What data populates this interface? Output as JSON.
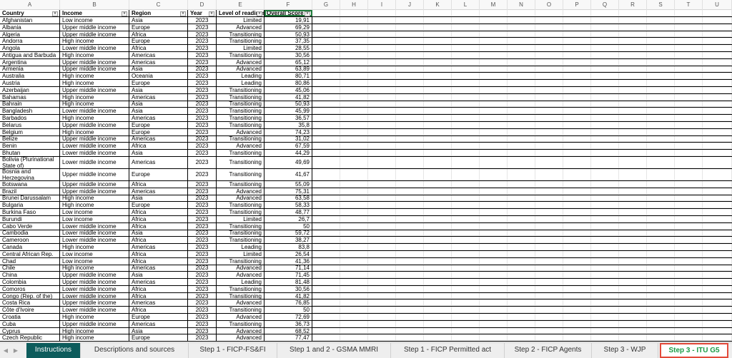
{
  "columns": [
    "A",
    "B",
    "C",
    "D",
    "E",
    "F",
    "G",
    "H",
    "I",
    "J",
    "K",
    "L",
    "M",
    "N",
    "O",
    "P",
    "Q",
    "R",
    "S",
    "T",
    "U"
  ],
  "table_headers": [
    "Country",
    "Income",
    "Region",
    "Year",
    "Level of readiness",
    "Overall Score"
  ],
  "rows": [
    [
      "Afghanistan",
      "Low income",
      "Asia",
      "2023",
      "Limited",
      "19,91"
    ],
    [
      "Albania",
      "Upper middle income",
      "Europe",
      "2023",
      "Advanced",
      "69,29"
    ],
    [
      "Algeria",
      "Upper middle income",
      "Africa",
      "2023",
      "Transitioning",
      "50,93"
    ],
    [
      "Andorra",
      "High income",
      "Europe",
      "2023",
      "Transitioning",
      "37,35"
    ],
    [
      "Angola",
      "Lower middle income",
      "Africa",
      "2023",
      "Limited",
      "28,55"
    ],
    [
      "Antigua and Barbuda",
      "High income",
      "Americas",
      "2023",
      "Transitioning",
      "30,56"
    ],
    [
      "Argentina",
      "Upper middle income",
      "Americas",
      "2023",
      "Advanced",
      "65,12"
    ],
    [
      "Armenia",
      "Upper middle income",
      "Asia",
      "2023",
      "Advanced",
      "63,89"
    ],
    [
      "Australia",
      "High income",
      "Oceania",
      "2023",
      "Leading",
      "80,71"
    ],
    [
      "Austria",
      "High income",
      "Europe",
      "2023",
      "Leading",
      "80,86"
    ],
    [
      "Azerbaijan",
      "Upper middle income",
      "Asia",
      "2023",
      "Transitioning",
      "45,06"
    ],
    [
      "Bahamas",
      "High income",
      "Americas",
      "2023",
      "Transitioning",
      "41,82"
    ],
    [
      "Bahrain",
      "High income",
      "Asia",
      "2023",
      "Transitioning",
      "50,93"
    ],
    [
      "Bangladesh",
      "Lower middle income",
      "Asia",
      "2023",
      "Transitioning",
      "45,99"
    ],
    [
      "Barbados",
      "High income",
      "Americas",
      "2023",
      "Transitioning",
      "36,57"
    ],
    [
      "Belarus",
      "Upper middle income",
      "Europe",
      "2023",
      "Transitioning",
      "35,8"
    ],
    [
      "Belgium",
      "High income",
      "Europe",
      "2023",
      "Advanced",
      "74,23"
    ],
    [
      "Belize",
      "Upper middle income",
      "Americas",
      "2023",
      "Transitioning",
      "31,02"
    ],
    [
      "Benin",
      "Lower middle income",
      "Africa",
      "2023",
      "Advanced",
      "67,59"
    ],
    [
      "Bhutan",
      "Lower middle income",
      "Asia",
      "2023",
      "Transitioning",
      "44,29"
    ],
    [
      "Bolivia (Plurinational State of)",
      "Lower middle income",
      "Americas",
      "2023",
      "Transitioning",
      "49,69"
    ],
    [
      "Bosnia and Herzegovina",
      "Upper middle income",
      "Europe",
      "2023",
      "Transitioning",
      "41,67"
    ],
    [
      "Botswana",
      "Upper middle income",
      "Africa",
      "2023",
      "Transitioning",
      "55,09"
    ],
    [
      "Brazil",
      "Upper middle income",
      "Americas",
      "2023",
      "Advanced",
      "75,31"
    ],
    [
      "Brunei Darussalam",
      "High income",
      "Asia",
      "2023",
      "Advanced",
      "63,58"
    ],
    [
      "Bulgaria",
      "High income",
      "Europe",
      "2023",
      "Transitioning",
      "58,33"
    ],
    [
      "Burkina Faso",
      "Low income",
      "Africa",
      "2023",
      "Transitioning",
      "48,77"
    ],
    [
      "Burundi",
      "Low income",
      "Africa",
      "2023",
      "Limited",
      "26,7"
    ],
    [
      "Cabo Verde",
      "Lower middle income",
      "Africa",
      "2023",
      "Transitioning",
      "50"
    ],
    [
      "Cambodia",
      "Lower middle income",
      "Asia",
      "2023",
      "Transitioning",
      "59,72"
    ],
    [
      "Cameroon",
      "Lower middle income",
      "Africa",
      "2023",
      "Transitioning",
      "38,27"
    ],
    [
      "Canada",
      "High income",
      "Americas",
      "2023",
      "Leading",
      "83,8"
    ],
    [
      "Central African Rep.",
      "Low income",
      "Africa",
      "2023",
      "Limited",
      "26,54"
    ],
    [
      "Chad",
      "Low income",
      "Africa",
      "2023",
      "Transitioning",
      "41,36"
    ],
    [
      "Chile",
      "High income",
      "Americas",
      "2023",
      "Advanced",
      "71,14"
    ],
    [
      "China",
      "Upper middle income",
      "Asia",
      "2023",
      "Advanced",
      "71,45"
    ],
    [
      "Colombia",
      "Upper middle income",
      "Americas",
      "2023",
      "Leading",
      "81,48"
    ],
    [
      "Comoros",
      "Lower middle income",
      "Africa",
      "2023",
      "Transitioning",
      "30,56"
    ],
    [
      "Congo (Rep. of the)",
      "Lower middle income",
      "Africa",
      "2023",
      "Transitioning",
      "41,82"
    ],
    [
      "Costa Rica",
      "Upper middle income",
      "Americas",
      "2023",
      "Advanced",
      "76,85"
    ],
    [
      "Côte d'Ivoire",
      "Lower middle income",
      "Africa",
      "2023",
      "Transitioning",
      "50"
    ],
    [
      "Croatia",
      "High income",
      "Europe",
      "2023",
      "Advanced",
      "72,69"
    ],
    [
      "Cuba",
      "Upper middle income",
      "Americas",
      "2023",
      "Transitioning",
      "36,73"
    ],
    [
      "Cyprus",
      "High income",
      "Asia",
      "2023",
      "Advanced",
      "68,52"
    ],
    [
      "Czech Republic",
      "High income",
      "Europe",
      "2023",
      "Advanced",
      "77,47"
    ]
  ],
  "sheet_tabs": [
    "Instructions",
    "Descriptions and sources",
    "Step 1 - FICP-FS&FI",
    "Step 1 and 2 - GSMA MMRI",
    "Step 1 - FICP Permitted act",
    "Step 2 - FICP Agents",
    "Step 3 - WJP",
    "Step 3 - ITU G5"
  ],
  "active_tab": "Step 3 - ITU G5",
  "icons": {
    "prev_sheet": "triangle-left-icon",
    "next_sheet": "triangle-right-icon",
    "filter": "filter-dropdown-icon"
  },
  "colors": {
    "instructions_tab": "#0d5c5c",
    "active_tab_text": "#1a9b45",
    "active_tab_border": "#e34b3b",
    "selected_cell": "#1f7a3b"
  }
}
